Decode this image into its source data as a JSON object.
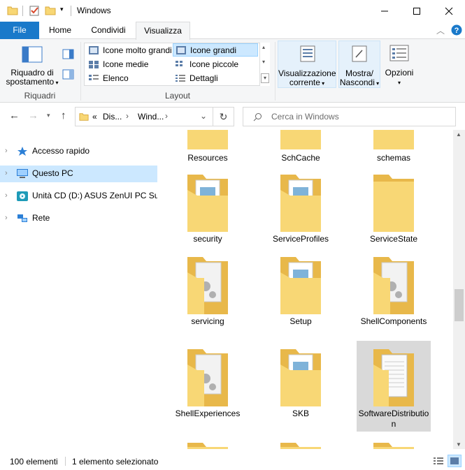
{
  "window": {
    "title": "Windows",
    "minimize_icon": "minimize-icon",
    "maximize_icon": "maximize-icon",
    "close_icon": "close-icon"
  },
  "ribbon_tabs": {
    "file": "File",
    "home": "Home",
    "share": "Condividi",
    "view": "Visualizza"
  },
  "ribbon": {
    "nav_pane_button": "Riquadro di spostamento",
    "group_panes": "Riquadri",
    "group_layout": "Layout",
    "layout_items": {
      "extra_large": "Icone molto grandi",
      "large": "Icone grandi",
      "medium": "Icone medie",
      "small": "Icone piccole",
      "list": "Elenco",
      "details": "Dettagli"
    },
    "current_view": "Visualizzazione corrente",
    "show_hide": "Mostra/ Nascondi",
    "options": "Opzioni",
    "selected_layout": "Icone grandi"
  },
  "address": {
    "prefix": "«",
    "crumb1": "Dis...",
    "crumb2": "Wind...",
    "search_placeholder": "Cerca in Windows"
  },
  "nav_pane": {
    "items": [
      {
        "label": "Accesso rapido"
      },
      {
        "label": "Questo PC"
      },
      {
        "label": "Unità CD (D:) ASUS ZenUI PC Suite"
      },
      {
        "label": "Rete"
      }
    ]
  },
  "files": {
    "row0": [
      "Resources",
      "SchCache",
      "schemas"
    ],
    "row1": [
      "security",
      "ServiceProfiles",
      "ServiceState"
    ],
    "row2": [
      "servicing",
      "Setup",
      "ShellComponents"
    ],
    "row3": [
      "ShellExperiences",
      "SKB",
      "SoftwareDistribution"
    ],
    "selected": "SoftwareDistribution"
  },
  "status": {
    "count": "100 elementi",
    "selection": "1 elemento selezionato"
  },
  "colors": {
    "accent": "#1979ca",
    "selection": "#cce8ff",
    "folder": "#f8d775",
    "folder_dark": "#e8b84a"
  }
}
